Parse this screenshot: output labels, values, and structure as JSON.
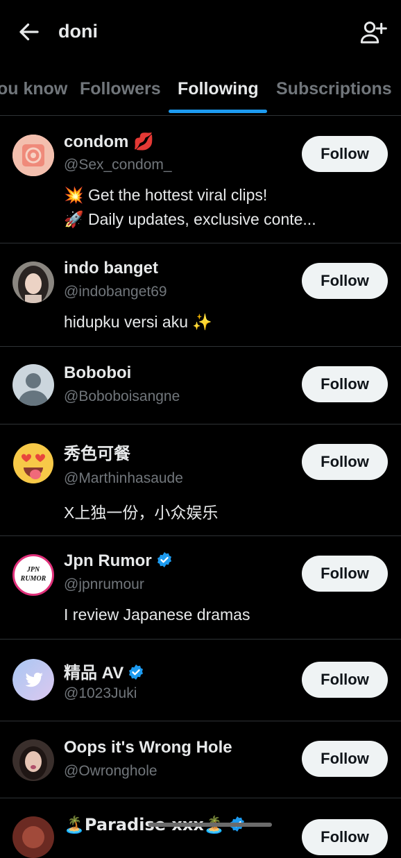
{
  "header": {
    "title": "doni",
    "back_icon": "arrow-left-icon",
    "add_icon": "add-user-icon"
  },
  "tabs": [
    {
      "label": "ou know",
      "active": false
    },
    {
      "label": "Followers",
      "active": false
    },
    {
      "label": "Following",
      "active": true
    },
    {
      "label": "Subscriptions",
      "active": false
    }
  ],
  "accent": "#1d9bf0",
  "follow_label": "Follow",
  "users": [
    {
      "name": "condom",
      "name_emoji": "💋",
      "handle": "@Sex_condom_",
      "bio_line1": "💥 Get the hottest viral clips!",
      "bio_line2": "🚀 Daily updates, exclusive conte...",
      "verified": false
    },
    {
      "name": "indo banget",
      "handle": "@indobanget69",
      "bio_line1": "hidupku versi aku ✨",
      "verified": false
    },
    {
      "name": "Boboboi",
      "handle": "@Boboboisangne",
      "verified": false
    },
    {
      "name": "秀色可餐",
      "handle": "@Marthinhasaude",
      "bio_line1": "X上独一份，小众娱乐",
      "verified": false
    },
    {
      "name": "Jpn Rumor",
      "handle": "@jpnrumour",
      "bio_line1": "I review Japanese dramas",
      "verified": true,
      "avatar_text_1": "JPN",
      "avatar_text_2": "RUMOR"
    },
    {
      "name": "精品 AV",
      "handle": "@1023Juki",
      "verified": true
    },
    {
      "name": "Oops it's Wrong Hole",
      "handle": "@Owronghole",
      "verified": false
    },
    {
      "name": "🏝️Paradise xxx🏝️",
      "verified": true
    }
  ]
}
